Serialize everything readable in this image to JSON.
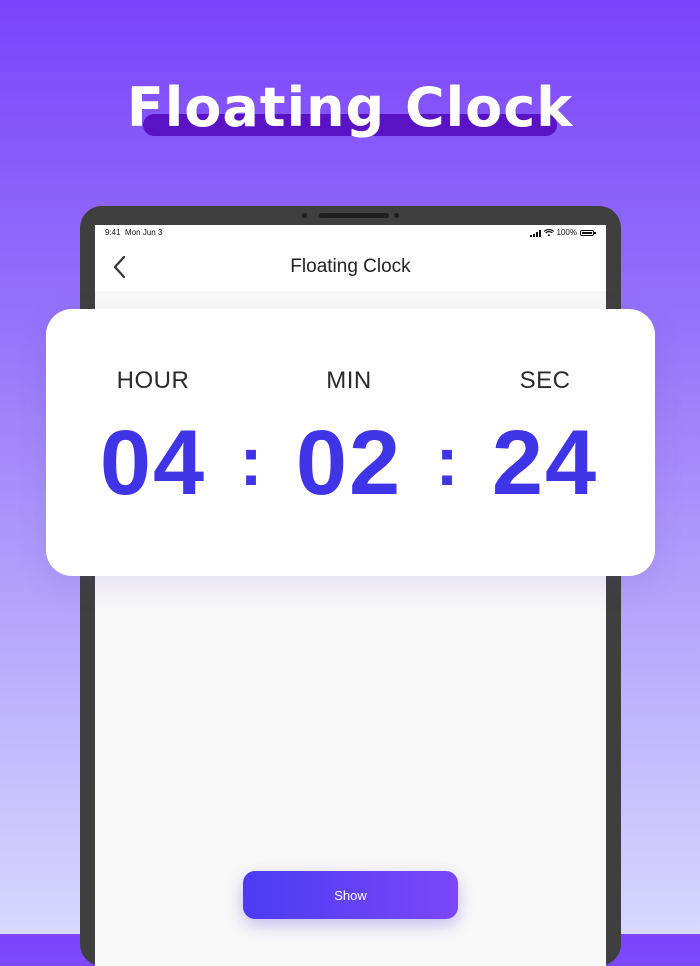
{
  "headline": "Floating Clock",
  "status_bar": {
    "time": "9:41",
    "date": "Mon Jun 3",
    "battery": "100%"
  },
  "nav": {
    "title": "Floating Clock",
    "back_icon": "chevron-left-icon"
  },
  "clock": {
    "hour_label": "HOUR",
    "min_label": "MIN",
    "sec_label": "SEC",
    "hour": "04",
    "min": "02",
    "sec": "24",
    "separator": ":"
  },
  "show_button": "Show",
  "colors": {
    "accent": "#3f34e6",
    "headline_underline": "#5a13c4",
    "button_start": "#4b3cf3",
    "button_end": "#7b47f9"
  }
}
